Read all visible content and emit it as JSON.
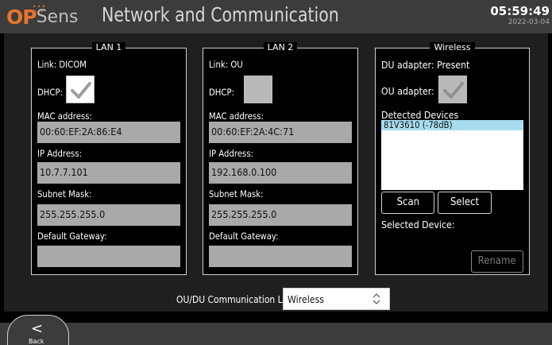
{
  "header": {
    "logo_op": "OP",
    "logo_sens": "Sens",
    "title": "Network and Communication",
    "time": "05:59:49",
    "date": "2022-03-04"
  },
  "lan1": {
    "legend": "LAN 1",
    "link": "Link: DICOM",
    "dhcp_label": "DHCP:",
    "dhcp_checked": true,
    "mac_label": "MAC address:",
    "mac_value": "00:60:EF:2A:86:E4",
    "ip_label": "IP Address:",
    "ip_value": "10.7.7.101",
    "subnet_label": "Subnet Mask:",
    "subnet_value": "255.255.255.0",
    "gateway_label": "Default Gateway:",
    "gateway_value": ""
  },
  "lan2": {
    "legend": "LAN 2",
    "link": "Link: OU",
    "dhcp_label": "DHCP:",
    "dhcp_checked": false,
    "mac_label": "MAC address:",
    "mac_value": "00:60:EF:2A:4C:71",
    "ip_label": "IP Address:",
    "ip_value": "192.168.0.100",
    "subnet_label": "Subnet Mask:",
    "subnet_value": "255.255.255.0",
    "gateway_label": "Default Gateway:",
    "gateway_value": ""
  },
  "wireless": {
    "legend": "Wireless",
    "du_adapter": "DU adapter: Present",
    "ou_adapter_label": "OU adapter:",
    "ou_adapter_checked": true,
    "detected_label": "Detected Devices",
    "devices": [
      "81V3610 (-78dB)"
    ],
    "scan_label": "Scan",
    "select_label": "Select",
    "selected_device_label": "Selected Device:",
    "rename_label": "Rename"
  },
  "link": {
    "label": "OU/DU Communication Link",
    "value": "Wireless"
  },
  "footer": {
    "back_label": "Back"
  },
  "colors": {
    "brand_orange": "#e8742a",
    "header_bg": "#3c3c3c",
    "field_bg": "#a9a9a9",
    "selected_device_bg": "#a8dcef"
  }
}
